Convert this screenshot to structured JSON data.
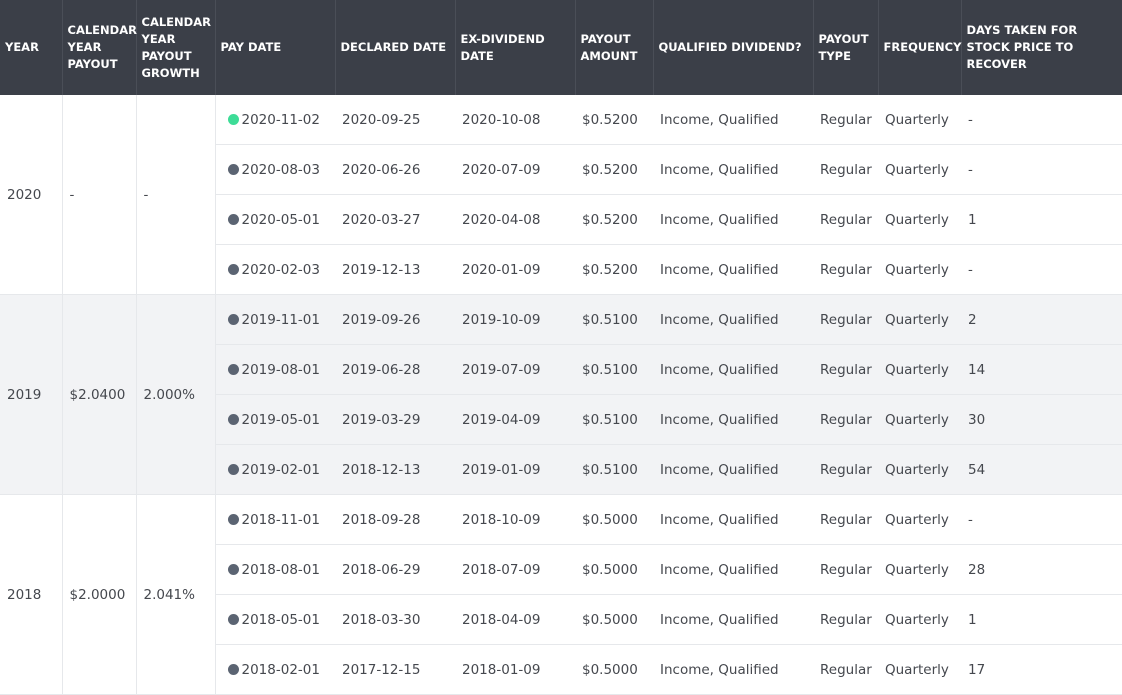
{
  "headers": {
    "year": "YEAR",
    "cal_payout": "CALENDAR YEAR PAYOUT",
    "cal_growth": "CALENDAR YEAR PAYOUT GROWTH",
    "pay_date": "PAY DATE",
    "declared": "DECLARED DATE",
    "ex_div": "EX-DIVIDEND DATE",
    "amount": "PAYOUT AMOUNT",
    "qualified": "QUALIFIED DIVIDEND?",
    "type": "PAYOUT TYPE",
    "frequency": "FREQUENCY",
    "recover": "DAYS TAKEN FOR STOCK PRICE TO RECOVER"
  },
  "colors": {
    "header_bg": "#3b3f48",
    "dot_upcoming": "#3ddc97",
    "dot_past": "#5b6472",
    "alt_row": "#f2f3f5"
  },
  "years": [
    {
      "year": "2020",
      "payout": "-",
      "growth": "-",
      "rows": [
        {
          "status": "upcoming",
          "pay": "2020-11-02",
          "declared": "2020-09-25",
          "ex": "2020-10-08",
          "amount": "$0.5200",
          "qualified": "Income, Qualified",
          "type": "Regular",
          "frequency": "Quarterly",
          "recover": "-"
        },
        {
          "status": "paid",
          "pay": "2020-08-03",
          "declared": "2020-06-26",
          "ex": "2020-07-09",
          "amount": "$0.5200",
          "qualified": "Income, Qualified",
          "type": "Regular",
          "frequency": "Quarterly",
          "recover": "-"
        },
        {
          "status": "paid",
          "pay": "2020-05-01",
          "declared": "2020-03-27",
          "ex": "2020-04-08",
          "amount": "$0.5200",
          "qualified": "Income, Qualified",
          "type": "Regular",
          "frequency": "Quarterly",
          "recover": "1"
        },
        {
          "status": "paid",
          "pay": "2020-02-03",
          "declared": "2019-12-13",
          "ex": "2020-01-09",
          "amount": "$0.5200",
          "qualified": "Income, Qualified",
          "type": "Regular",
          "frequency": "Quarterly",
          "recover": "-"
        }
      ]
    },
    {
      "year": "2019",
      "payout": "$2.0400",
      "growth": "2.000%",
      "rows": [
        {
          "status": "paid",
          "pay": "2019-11-01",
          "declared": "2019-09-26",
          "ex": "2019-10-09",
          "amount": "$0.5100",
          "qualified": "Income, Qualified",
          "type": "Regular",
          "frequency": "Quarterly",
          "recover": "2"
        },
        {
          "status": "paid",
          "pay": "2019-08-01",
          "declared": "2019-06-28",
          "ex": "2019-07-09",
          "amount": "$0.5100",
          "qualified": "Income, Qualified",
          "type": "Regular",
          "frequency": "Quarterly",
          "recover": "14"
        },
        {
          "status": "paid",
          "pay": "2019-05-01",
          "declared": "2019-03-29",
          "ex": "2019-04-09",
          "amount": "$0.5100",
          "qualified": "Income, Qualified",
          "type": "Regular",
          "frequency": "Quarterly",
          "recover": "30"
        },
        {
          "status": "paid",
          "pay": "2019-02-01",
          "declared": "2018-12-13",
          "ex": "2019-01-09",
          "amount": "$0.5100",
          "qualified": "Income, Qualified",
          "type": "Regular",
          "frequency": "Quarterly",
          "recover": "54"
        }
      ]
    },
    {
      "year": "2018",
      "payout": "$2.0000",
      "growth": "2.041%",
      "rows": [
        {
          "status": "paid",
          "pay": "2018-11-01",
          "declared": "2018-09-28",
          "ex": "2018-10-09",
          "amount": "$0.5000",
          "qualified": "Income, Qualified",
          "type": "Regular",
          "frequency": "Quarterly",
          "recover": "-"
        },
        {
          "status": "paid",
          "pay": "2018-08-01",
          "declared": "2018-06-29",
          "ex": "2018-07-09",
          "amount": "$0.5000",
          "qualified": "Income, Qualified",
          "type": "Regular",
          "frequency": "Quarterly",
          "recover": "28"
        },
        {
          "status": "paid",
          "pay": "2018-05-01",
          "declared": "2018-03-30",
          "ex": "2018-04-09",
          "amount": "$0.5000",
          "qualified": "Income, Qualified",
          "type": "Regular",
          "frequency": "Quarterly",
          "recover": "1"
        },
        {
          "status": "paid",
          "pay": "2018-02-01",
          "declared": "2017-12-15",
          "ex": "2018-01-09",
          "amount": "$0.5000",
          "qualified": "Income, Qualified",
          "type": "Regular",
          "frequency": "Quarterly",
          "recover": "17"
        }
      ]
    }
  ]
}
